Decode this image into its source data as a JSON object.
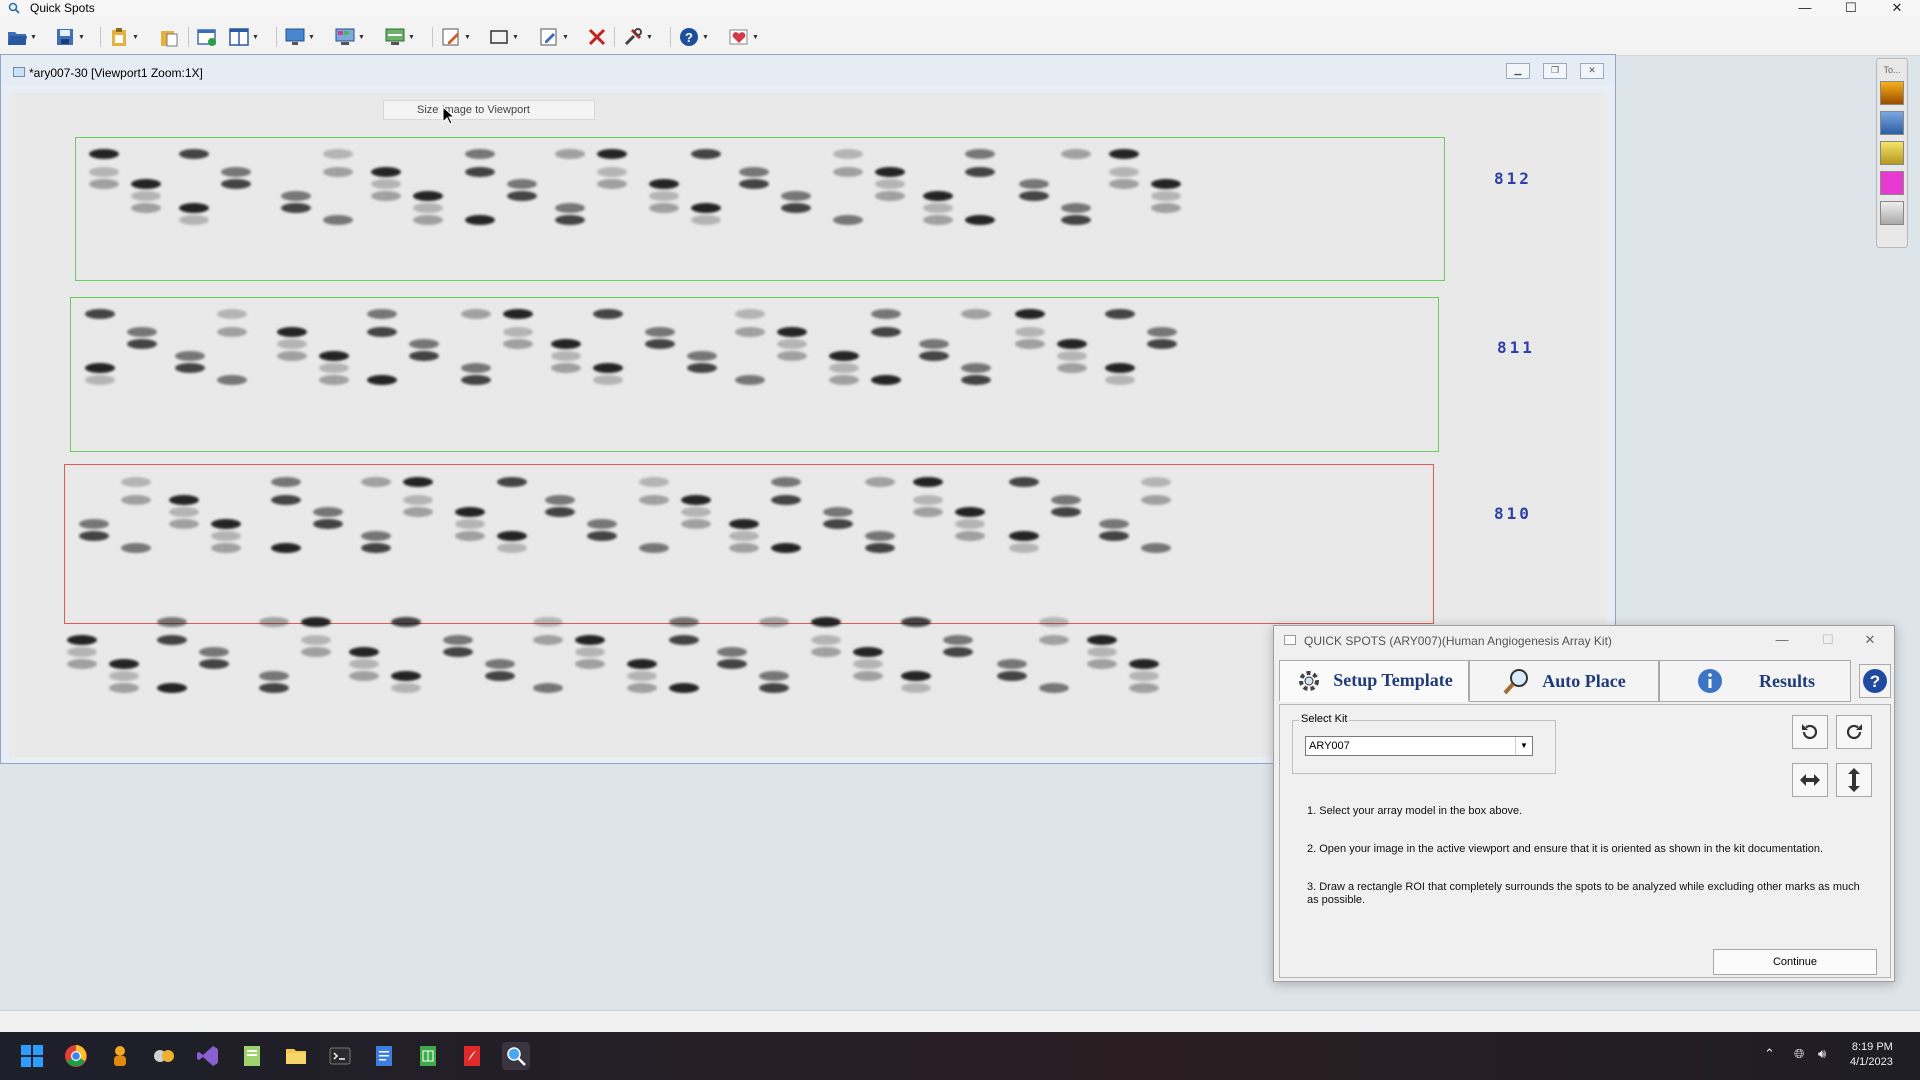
{
  "app": {
    "title": "Quick Spots"
  },
  "window_controls": {
    "minimize": "—",
    "maximize": "☐",
    "close": "✕"
  },
  "document": {
    "title": "*ary007-30 [Viewport1 Zoom:1X]"
  },
  "viewport": {
    "tooltip": "Size Image to Viewport",
    "row_labels": [
      "812",
      "811",
      "810"
    ]
  },
  "side_panel": {
    "label": "To..."
  },
  "dialog": {
    "title": "QUICK SPOTS (ARY007)(Human Angiogenesis Array Kit)",
    "tabs": [
      {
        "label": "Setup Template",
        "active": true
      },
      {
        "label": "Auto Place",
        "active": false
      },
      {
        "label": "Results",
        "active": false
      }
    ],
    "select_kit": {
      "legend": "Select Kit",
      "value": "ARY007"
    },
    "instructions": [
      "1. Select your array model in the box above.",
      "2. Open your image in the active viewport and ensure that it is oriented as shown in the kit documentation.",
      "3. Draw a rectangle ROI that completely surrounds the spots to be analyzed while excluding other marks as much as possible."
    ],
    "continue_label": "Continue"
  },
  "clock": {
    "time": "8:19 PM",
    "date": "4/1/2023"
  },
  "colors": {
    "roi_selected": "#6ecb62",
    "roi_active": "#e05a5a",
    "label_blue": "#2d3ea8",
    "tab_text": "#1f3b7a"
  }
}
